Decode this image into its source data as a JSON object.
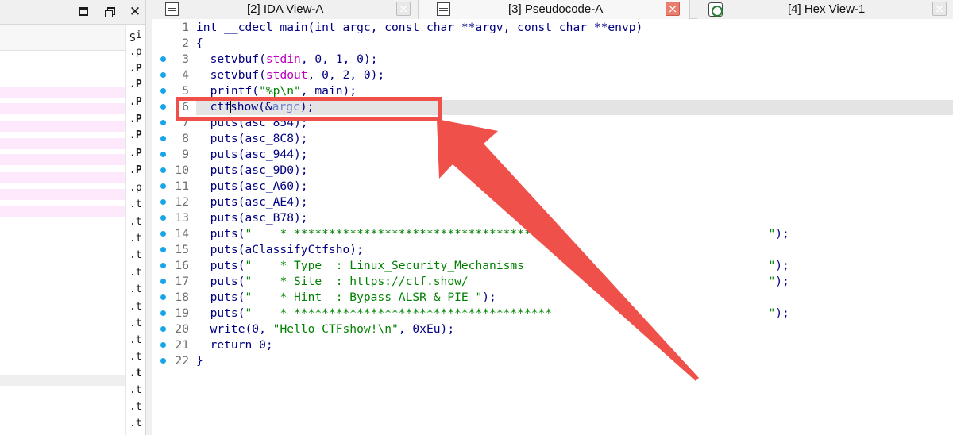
{
  "window": {
    "maximize_label": "maximize",
    "restore_label": "restore",
    "close_label": "close"
  },
  "left_panel": {
    "segment_header": "S",
    "segments": [
      {
        "text": ".in",
        "bold": false
      },
      {
        "text": ".p",
        "bold": false
      },
      {
        "text": ".P",
        "bold": true
      },
      {
        "text": ".P",
        "bold": true
      },
      {
        "text": ".P",
        "bold": true
      },
      {
        "text": ".P",
        "bold": true
      },
      {
        "text": ".P",
        "bold": true
      },
      {
        "text": ".P",
        "bold": true
      },
      {
        "text": ".P",
        "bold": true
      },
      {
        "text": ".p",
        "bold": false
      },
      {
        "text": ".te",
        "bold": false
      },
      {
        "text": ".te",
        "bold": false
      },
      {
        "text": ".te",
        "bold": false
      },
      {
        "text": ".te",
        "bold": false
      },
      {
        "text": ".te",
        "bold": false
      },
      {
        "text": ".te",
        "bold": false
      },
      {
        "text": ".te",
        "bold": false
      },
      {
        "text": ".te",
        "bold": false
      },
      {
        "text": ".te",
        "bold": false
      },
      {
        "text": ".te",
        "bold": false
      },
      {
        "text": ".t",
        "bold": true
      },
      {
        "text": ".te",
        "bold": false
      },
      {
        "text": ".te",
        "bold": false
      },
      {
        "text": ".te",
        "bold": false
      }
    ]
  },
  "tabs": [
    {
      "label": "[2] IDA View-A",
      "icon": "disassembly-view-icon",
      "active": false
    },
    {
      "label": "[3] Pseudocode-A",
      "icon": "pseudocode-view-icon",
      "active": true
    },
    {
      "label": "[4] Hex View-1",
      "icon": "hex-view-icon",
      "active": false
    }
  ],
  "tab_close_glyph": "×",
  "code": {
    "current_line": 6,
    "lines": [
      {
        "no": "1",
        "bp": false,
        "tokens": [
          [
            "k",
            "int __cdecl main(int argc, const char **argv, const char **envp)"
          ]
        ]
      },
      {
        "no": "2",
        "bp": false,
        "tokens": [
          [
            "k",
            "{"
          ]
        ]
      },
      {
        "no": "3",
        "bp": true,
        "tokens": [
          [
            "k",
            "  setvbuf("
          ],
          [
            "m",
            "stdin"
          ],
          [
            "k",
            ", 0, 1, 0);"
          ]
        ]
      },
      {
        "no": "4",
        "bp": true,
        "tokens": [
          [
            "k",
            "  setvbuf("
          ],
          [
            "m",
            "stdout"
          ],
          [
            "k",
            ", 0, 2, 0);"
          ]
        ]
      },
      {
        "no": "5",
        "bp": true,
        "tokens": [
          [
            "k",
            "  printf("
          ],
          [
            "s",
            "\"%p\\n\""
          ],
          [
            "k",
            ", main);"
          ]
        ]
      },
      {
        "no": "6",
        "bp": true,
        "tokens": [
          [
            "k",
            "  ctf"
          ],
          [
            "caret",
            ""
          ],
          [
            "k",
            "show(&"
          ],
          [
            "v",
            "argc"
          ],
          [
            "k",
            ");"
          ]
        ]
      },
      {
        "no": "7",
        "bp": true,
        "tokens": [
          [
            "k",
            "  puts(asc_854);"
          ]
        ]
      },
      {
        "no": "8",
        "bp": true,
        "tokens": [
          [
            "k",
            "  puts(asc_8C8);"
          ]
        ]
      },
      {
        "no": "9",
        "bp": true,
        "tokens": [
          [
            "k",
            "  puts(asc_944);"
          ]
        ]
      },
      {
        "no": "10",
        "bp": true,
        "tokens": [
          [
            "k",
            "  puts(asc_9D0);"
          ]
        ]
      },
      {
        "no": "11",
        "bp": true,
        "tokens": [
          [
            "k",
            "  puts(asc_A60);"
          ]
        ]
      },
      {
        "no": "12",
        "bp": true,
        "tokens": [
          [
            "k",
            "  puts(asc_AE4);"
          ]
        ]
      },
      {
        "no": "13",
        "bp": true,
        "tokens": [
          [
            "k",
            "  puts(asc_B78);"
          ]
        ]
      },
      {
        "no": "14",
        "bp": true,
        "tokens": [
          [
            "k",
            "  puts("
          ],
          [
            "s",
            "\"    * *************************************                               \""
          ],
          [
            "k",
            ");"
          ]
        ]
      },
      {
        "no": "15",
        "bp": true,
        "tokens": [
          [
            "k",
            "  puts(aClassifyCtfsho);"
          ]
        ]
      },
      {
        "no": "16",
        "bp": true,
        "tokens": [
          [
            "k",
            "  puts("
          ],
          [
            "s",
            "\"    * Type  : Linux_Security_Mechanisms                                   \""
          ],
          [
            "k",
            ");"
          ]
        ]
      },
      {
        "no": "17",
        "bp": true,
        "tokens": [
          [
            "k",
            "  puts("
          ],
          [
            "s",
            "\"    * Site  : https://ctf.show/                                           \""
          ],
          [
            "k",
            ");"
          ]
        ]
      },
      {
        "no": "18",
        "bp": true,
        "tokens": [
          [
            "k",
            "  puts("
          ],
          [
            "s",
            "\"    * Hint  : Bypass ALSR & PIE \""
          ],
          [
            "k",
            ");"
          ]
        ]
      },
      {
        "no": "19",
        "bp": true,
        "tokens": [
          [
            "k",
            "  puts("
          ],
          [
            "s",
            "\"    * *************************************                               \""
          ],
          [
            "k",
            ");"
          ]
        ]
      },
      {
        "no": "20",
        "bp": true,
        "tokens": [
          [
            "k",
            "  write(0, "
          ],
          [
            "s",
            "\"Hello CTFshow!\\n\""
          ],
          [
            "k",
            ", 0xEu);"
          ]
        ]
      },
      {
        "no": "21",
        "bp": true,
        "tokens": [
          [
            "k",
            "  return 0;"
          ]
        ]
      },
      {
        "no": "22",
        "bp": true,
        "tokens": [
          [
            "k",
            "}"
          ]
        ]
      }
    ]
  },
  "colors": {
    "annotation_red": "#f0504a",
    "breakpoint_dot": "#18a4e8",
    "keyword_navy": "#000080",
    "string_green": "#008000",
    "global_magenta": "#c000c0",
    "local_var_blue": "#6f7fcf",
    "pink_row": "#fde9fb"
  }
}
